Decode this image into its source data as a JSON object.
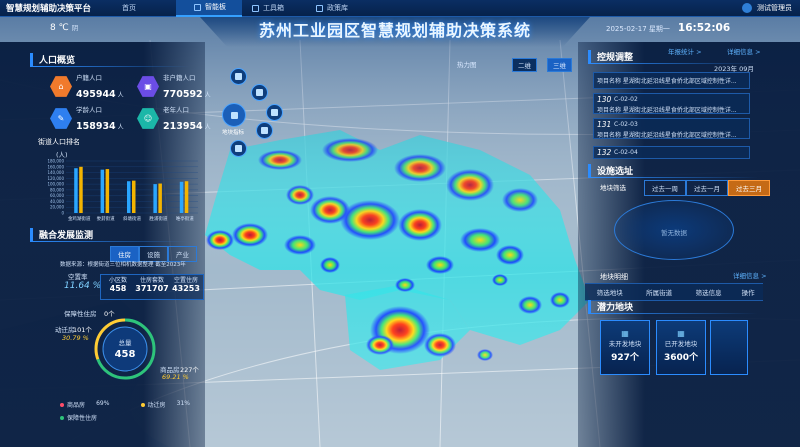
{
  "nav": {
    "brand": "智慧规划辅助决策平台",
    "tabs": [
      "首页",
      "智能板",
      "工具箱",
      "政策库"
    ],
    "user": "测试管理员"
  },
  "header": {
    "title": "苏州工业园区智慧规划辅助决策系统",
    "temp": "8 ℃",
    "weather": "阴",
    "date": "2025-02-17 星期一",
    "time": "16:52:06"
  },
  "map": {
    "indicator_label": "地块指标",
    "heatmap": "热力图",
    "view_2d": "二维",
    "view_3d": "三维"
  },
  "left": {
    "population": {
      "title": "人口概览",
      "items": [
        {
          "label": "户籍人口",
          "value": "495944",
          "unit": "人"
        },
        {
          "label": "非户籍人口",
          "value": "770592",
          "unit": "人"
        },
        {
          "label": "学龄人口",
          "value": "158934",
          "unit": "人"
        },
        {
          "label": "老年人口",
          "value": "213954",
          "unit": "人"
        }
      ]
    },
    "ranking": {
      "title": "街道人口排名",
      "unit": "(人)"
    },
    "integration": {
      "title": "融合发展监测",
      "tabs": [
        "住房",
        "设施",
        "产业"
      ],
      "source": "数据来源：根据街道三位相机数据整理   截至2023年",
      "vacancy_label": "空置率",
      "vacancy_value": "11.64 %",
      "kpis": [
        {
          "label": "小区数",
          "value": "458"
        },
        {
          "label": "住房套数",
          "value": "371707"
        },
        {
          "label": "空置住房",
          "value": "43253"
        }
      ],
      "donut": {
        "affordable_label": "保障性住房",
        "affordable_value": "0个",
        "resettle_label": "动迁房",
        "resettle_count": "101个",
        "resettle_percent": "30.79 %",
        "total_label": "总量",
        "total_value": "458",
        "commercial_label": "商品房",
        "commercial_count": "227个",
        "commercial_percent": "69.21 %"
      },
      "legend": [
        {
          "label": "商品房",
          "value": "69%"
        },
        {
          "label": "动迁房",
          "value": "31%"
        },
        {
          "label": "保障性住房",
          "value": ""
        }
      ]
    }
  },
  "right": {
    "regulatory": {
      "title": "控规调整",
      "link1": "年报统计 >",
      "link2": "详细信息 >",
      "period": "2023年 09月",
      "items": [
        {
          "no": "",
          "code": "",
          "name": "项目名称  星湖街北延沿线星食侨北部区域控制性详..."
        },
        {
          "no": "130",
          "code": "C-02-02",
          "name": "项目名称  星湖街北延沿线星食侨北部区域控制性详..."
        },
        {
          "no": "131",
          "code": "C-02-03",
          "name": "项目名称  星湖街北延沿线星食侨北部区域控制性详..."
        },
        {
          "no": "132",
          "code": "C-02-04",
          "name": ""
        }
      ]
    },
    "facility": {
      "title": "设施选址",
      "filter_label": "地块筛选",
      "ranges": [
        "过去一周",
        "过去一月",
        "过去三月"
      ],
      "no_data": "暂无数据"
    },
    "detail": {
      "title": "地块明细",
      "link": "详细信息 >",
      "columns": [
        "筛选地块",
        "所属街道",
        "筛选信息",
        "操作"
      ]
    },
    "potential": {
      "title": "潜力地块",
      "items": [
        {
          "label": "未开发地块",
          "value": "927个"
        },
        {
          "label": "已开发地块",
          "value": "3600个"
        }
      ]
    }
  },
  "chart_data": {
    "type": "bar",
    "title": "街道人口排名",
    "ylabel": "(人)",
    "ylim": [
      0,
      180000
    ],
    "yticks": [
      "180,000",
      "160,000",
      "140,000",
      "120,000",
      "100,000",
      "80,000",
      "60,000",
      "40,000",
      "20,000",
      "0"
    ],
    "categories": [
      "金鸡湖街道",
      "娄葑街道",
      "斜塘街道",
      "胜浦街道",
      "唯亭街道"
    ],
    "series": [
      {
        "values": [
          155000,
          150000,
          110000,
          100000,
          108000
        ]
      },
      {
        "values": [
          160000,
          152000,
          112000,
          102000,
          110000
        ]
      }
    ]
  }
}
